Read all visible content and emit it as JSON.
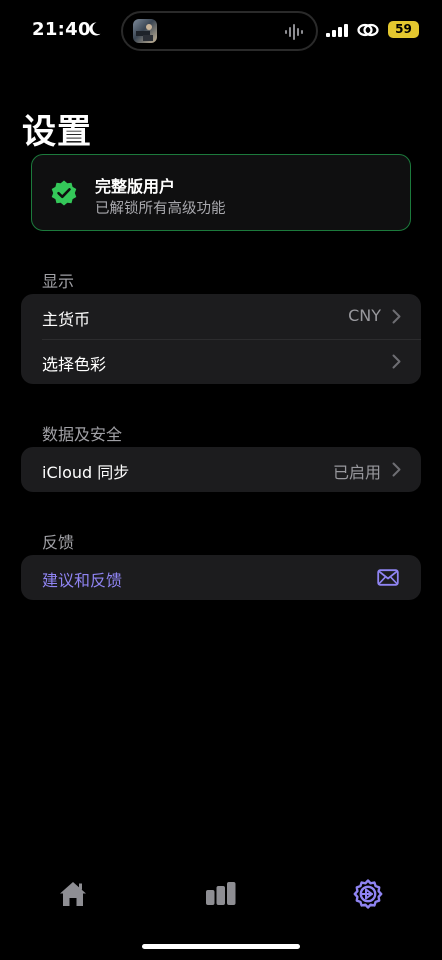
{
  "status_bar": {
    "time": "21:40",
    "battery": "59",
    "icons": [
      "moon-icon",
      "cellular-signal-icon",
      "link-icon",
      "battery-icon"
    ],
    "battery_color": "#e3c72f"
  },
  "page": {
    "title": "设置"
  },
  "premium": {
    "title": "完整版用户",
    "subtitle": "已解锁所有高级功能",
    "icon": "verified-badge-icon",
    "accent_color": "#34c759",
    "border_color": "#1c7a3c"
  },
  "sections": {
    "display": {
      "header": "显示",
      "rows": [
        {
          "label": "主货币",
          "value": "CNY"
        },
        {
          "label": "选择色彩",
          "value": ""
        }
      ]
    },
    "data_security": {
      "header": "数据及安全",
      "rows": [
        {
          "label": "iCloud 同步",
          "value": "已启用"
        }
      ]
    },
    "feedback": {
      "header": "反馈",
      "rows": [
        {
          "label": "建议和反馈",
          "icon": "mail-icon"
        }
      ]
    }
  },
  "tab_bar": {
    "tabs": [
      {
        "icon": "home-icon",
        "selected": false
      },
      {
        "icon": "bar-chart-icon",
        "selected": false
      },
      {
        "icon": "settings-gear-icon",
        "selected": true
      }
    ],
    "accent_color": "#8f84f2",
    "inactive_color": "#8e8e93"
  }
}
